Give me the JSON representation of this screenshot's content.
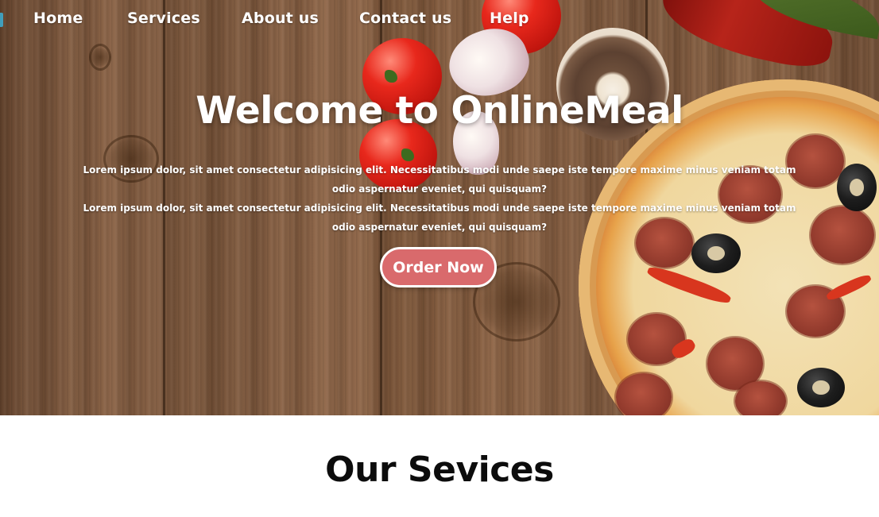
{
  "nav": {
    "items": [
      {
        "label": "Home"
      },
      {
        "label": "Services"
      },
      {
        "label": "About us"
      },
      {
        "label": "Contact us"
      },
      {
        "label": "Help"
      }
    ]
  },
  "hero": {
    "title": "Welcome to OnlineMeal",
    "paragraph_line1": "Lorem ipsum dolor, sit amet consectetur adipisicing elit. Necessitatibus modi unde saepe iste tempore maxime minus veniam totam odio aspernatur eveniet, qui quisquam?",
    "paragraph_line2": "Lorem ipsum dolor, sit amet consectetur adipisicing elit. Necessitatibus modi unde saepe iste tempore maxime minus veniam totam odio aspernatur eveniet, qui quisquam?",
    "button_label": "Order Now",
    "button_color": "#d96a6c"
  },
  "services": {
    "title": "Our Sevices"
  }
}
